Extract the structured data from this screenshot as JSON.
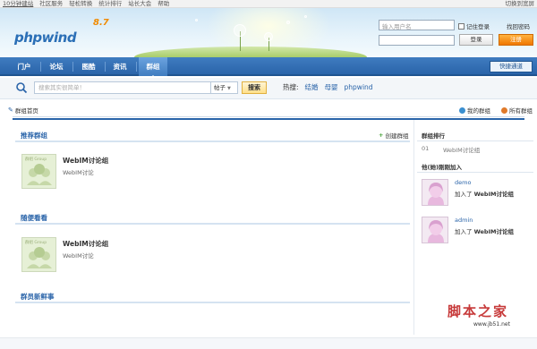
{
  "topbar": {
    "links": [
      "10分钟建站",
      "社区服务",
      "轻松转换",
      "统计排行",
      "站长大会",
      "帮助"
    ],
    "right_text": "切换到宽屏"
  },
  "header": {
    "logo": "phpwind",
    "version": "8.7",
    "username_placeholder": "输入用户名",
    "remember_label": "记住登录",
    "find_password": "找回密码",
    "login_button": "登录",
    "register_button": "注册"
  },
  "nav": {
    "items": [
      "门户",
      "论坛",
      "图酷",
      "资讯",
      "群组"
    ],
    "active_index": 4,
    "quick_nav": "快捷通道"
  },
  "search": {
    "placeholder": "搜索其实很简单！",
    "type_selected": "帖子",
    "button": "搜索",
    "hot_label": "热搜:",
    "hot_tags": [
      "结婚",
      "母婴",
      "phpwind"
    ]
  },
  "breadcrumb": "群组首页",
  "tabs": {
    "my_groups": "我的群组",
    "all_groups": "所有群组"
  },
  "main": {
    "recommended_title": "推荐群组",
    "create_group": "创建群组",
    "recommended": [
      {
        "name": "WebIM讨论组",
        "desc": "WebIM讨论"
      }
    ],
    "browse_title": "随便看看",
    "browse": [
      {
        "name": "WebIM讨论组",
        "desc": "WebIM讨论"
      }
    ],
    "news_title": "群员新鲜事"
  },
  "sidebar": {
    "rank_title": "群组排行",
    "rank_items": [
      {
        "no": "01",
        "name": "WebIM讨论组"
      }
    ],
    "recent_title": "他(她)刚刚加入",
    "recent": [
      {
        "user": "demo",
        "action": "加入了",
        "group": "WebIM讨论组"
      },
      {
        "user": "admin",
        "action": "加入了",
        "group": "WebIM讨论组"
      }
    ]
  },
  "watermark": {
    "text": "脚本之家",
    "url": "www.jb51.net"
  },
  "colors": {
    "nav_blue": "#2a64a9",
    "accent_orange": "#f07800",
    "link_blue": "#2a64a9"
  }
}
